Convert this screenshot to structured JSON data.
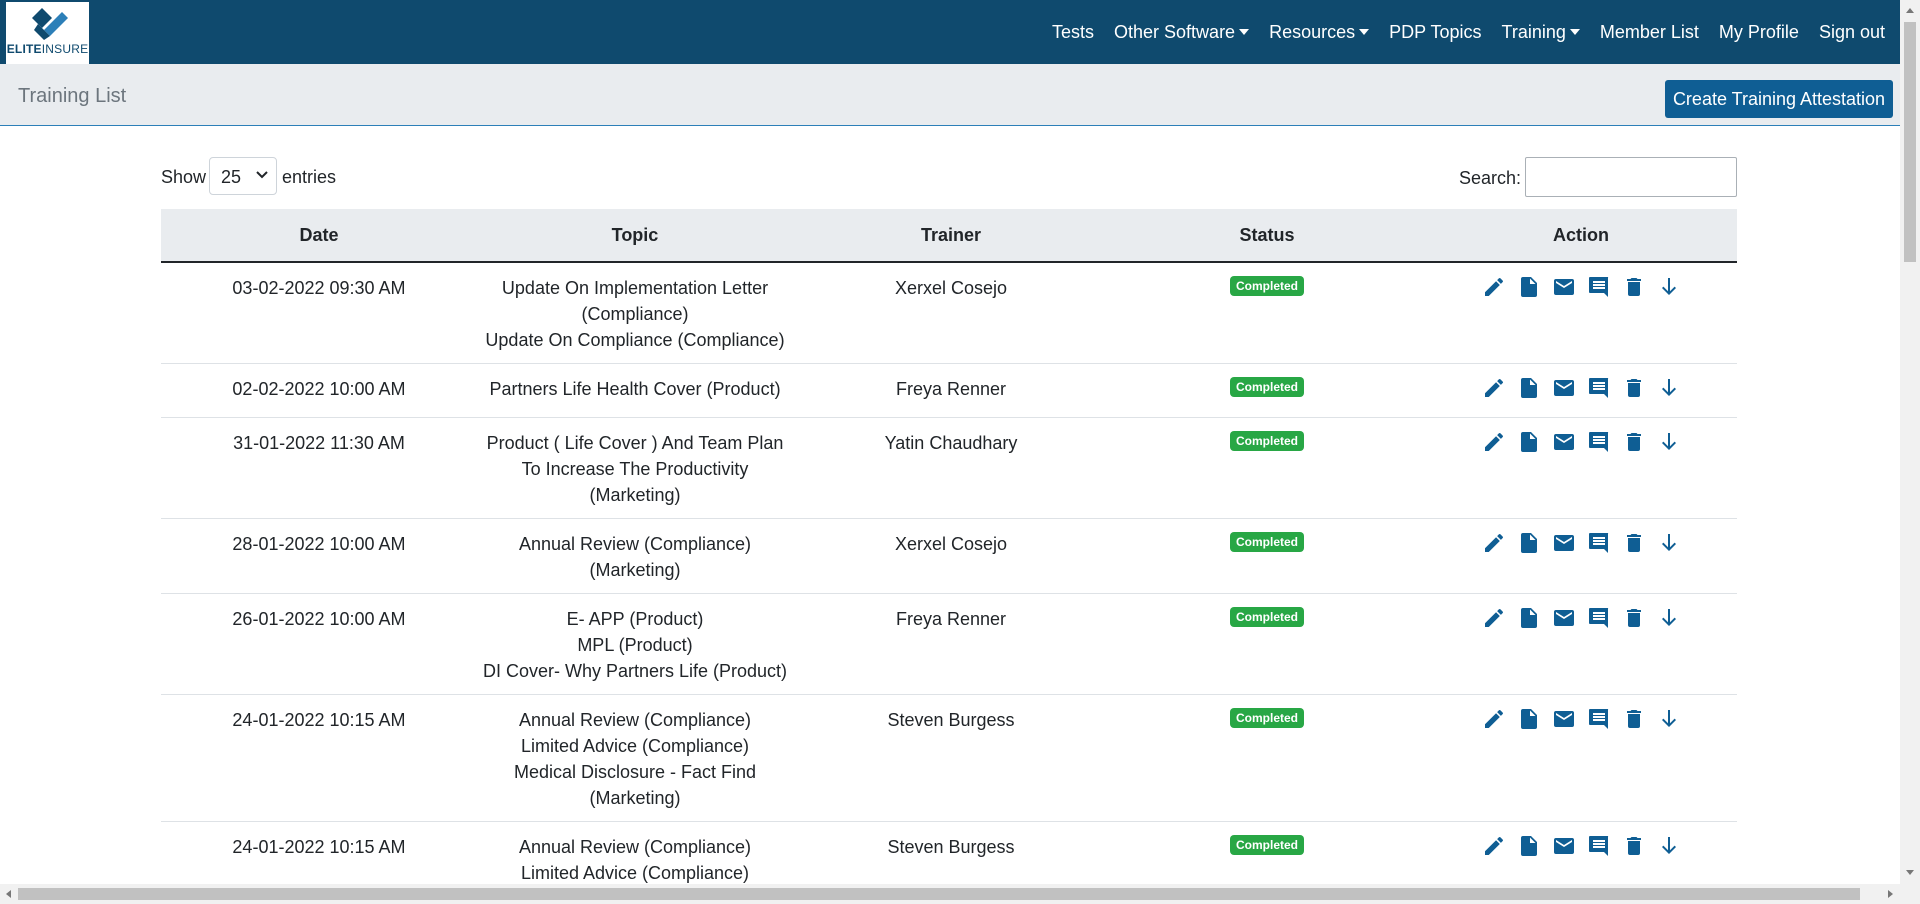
{
  "brand": {
    "logo_bold": "ELITE",
    "logo_thin": "INSURE"
  },
  "nav": [
    {
      "label": "Tests",
      "dropdown": false
    },
    {
      "label": "Other Software",
      "dropdown": true
    },
    {
      "label": "Resources",
      "dropdown": true
    },
    {
      "label": "PDP Topics",
      "dropdown": false
    },
    {
      "label": "Training",
      "dropdown": true
    },
    {
      "label": "Member List",
      "dropdown": false
    },
    {
      "label": "My Profile",
      "dropdown": false
    },
    {
      "label": "Sign out",
      "dropdown": false
    }
  ],
  "page": {
    "title": "Training List",
    "create_button": "Create Training Attestation"
  },
  "controls": {
    "show_label": "Show",
    "entries_value": "25",
    "entries_label": "entries",
    "search_label": "Search:",
    "search_value": ""
  },
  "table": {
    "columns": [
      "Date",
      "Topic",
      "Trainer",
      "Status",
      "Action"
    ],
    "rows": [
      {
        "date": "03-02-2022 09:30 AM",
        "topics": [
          "Update On Implementation Letter",
          "(Compliance)",
          "Update On Compliance (Compliance)"
        ],
        "trainer": "Xerxel Cosejo",
        "status": "Completed"
      },
      {
        "date": "02-02-2022 10:00 AM",
        "topics": [
          "Partners Life Health Cover (Product)"
        ],
        "trainer": "Freya Renner",
        "status": "Completed"
      },
      {
        "date": "31-01-2022 11:30 AM",
        "topics": [
          "Product ( Life Cover ) And Team Plan",
          "To Increase The Productivity",
          "(Marketing)"
        ],
        "trainer": "Yatin Chaudhary",
        "status": "Completed"
      },
      {
        "date": "28-01-2022 10:00 AM",
        "topics": [
          "Annual Review (Compliance)",
          "(Marketing)"
        ],
        "trainer": "Xerxel Cosejo",
        "status": "Completed"
      },
      {
        "date": "26-01-2022 10:00 AM",
        "topics": [
          "E- APP (Product)",
          "MPL (Product)",
          "DI Cover- Why Partners Life (Product)"
        ],
        "trainer": "Freya Renner",
        "status": "Completed"
      },
      {
        "date": "24-01-2022 10:15 AM",
        "topics": [
          "Annual Review (Compliance)",
          "Limited Advice (Compliance)",
          "Medical Disclosure - Fact Find",
          "(Marketing)"
        ],
        "trainer": "Steven Burgess",
        "status": "Completed"
      },
      {
        "date": "24-01-2022 10:15 AM",
        "topics": [
          "Annual Review (Compliance)",
          "Limited Advice (Compliance)"
        ],
        "trainer": "Steven Burgess",
        "status": "Completed"
      }
    ]
  },
  "action_icons": [
    "edit-icon",
    "document-icon",
    "email-icon",
    "comment-icon",
    "delete-icon",
    "download-icon"
  ],
  "colors": {
    "navbar": "#0f4a6e",
    "primary": "#0f5e94",
    "badge": "#28a745",
    "subheader": "#e9ecef"
  }
}
